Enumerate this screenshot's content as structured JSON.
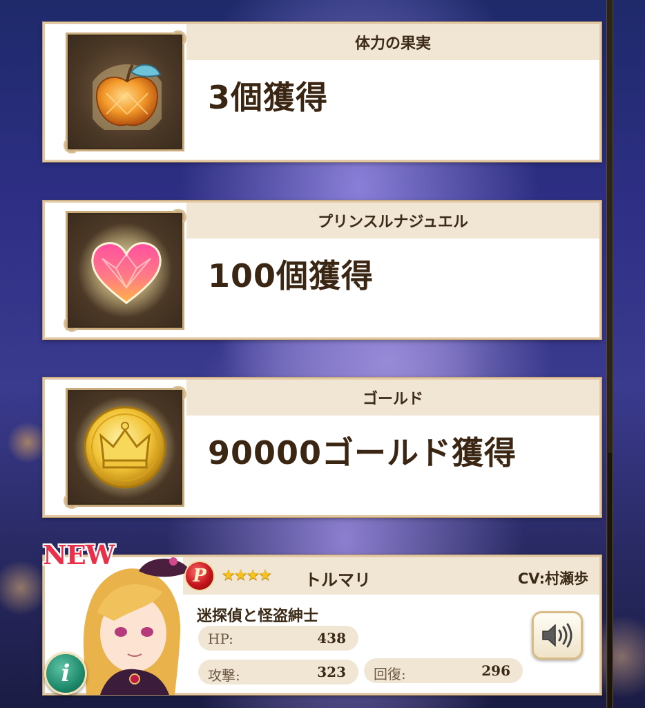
{
  "rewards": [
    {
      "title": "体力の果実",
      "result": "3個獲得",
      "icon": "apple-fruit-icon"
    },
    {
      "title": "プリンスルナジュエル",
      "result": "100個獲得",
      "icon": "heart-jewel-icon"
    },
    {
      "title": "ゴールド",
      "result": "90000ゴールド獲得",
      "icon": "gold-crown-coin-icon"
    }
  ],
  "character": {
    "badge": "NEW",
    "rarity_letter": "P",
    "stars": "★★★★",
    "name": "トルマリ",
    "cv": "CV:村瀬歩",
    "title": "迷探偵と怪盗紳士",
    "stats": {
      "hp_label": "HP:",
      "hp_value": "438",
      "attack_label": "攻撃:",
      "attack_value": "323",
      "recovery_label": "回復:",
      "recovery_value": "296"
    },
    "info_label": "i"
  },
  "colors": {
    "card_header_bg": "#f1e6d4",
    "card_border": "#e2c9a4",
    "text_dark": "#3a2612",
    "new_badge": "#e8304a",
    "rarity_red": "#c4151b",
    "info_green": "#1f8a6c"
  }
}
